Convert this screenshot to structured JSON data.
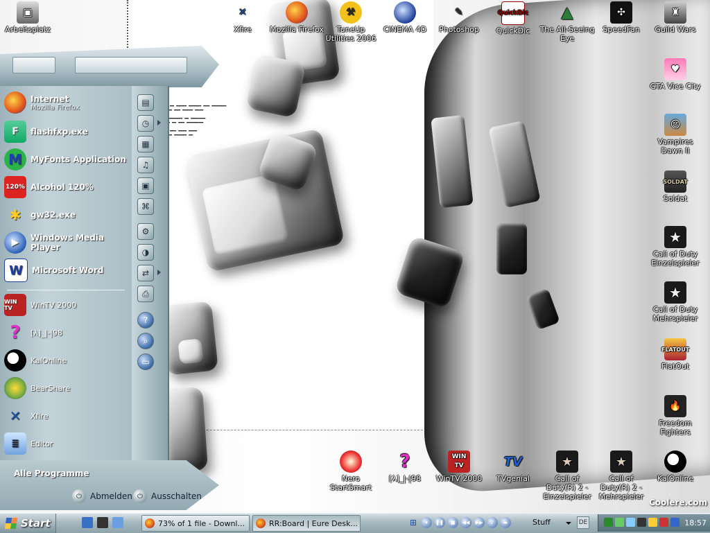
{
  "desktop": {
    "top_icons": [
      {
        "label": "Arbeitsplatz",
        "icon": "computer-icon"
      },
      {
        "label": "Xfire",
        "icon": "xfire-icon"
      },
      {
        "label": "Mozilla Firefox",
        "icon": "firefox-icon"
      },
      {
        "label": "TuneUp Utilities 2006",
        "icon": "tuneup-icon"
      },
      {
        "label": "CINEMA 4D",
        "icon": "cinema4d-icon"
      },
      {
        "label": "Photoshop",
        "icon": "photoshop-icon"
      },
      {
        "label": "QuickDic",
        "icon": "quickdic-icon"
      },
      {
        "label": "The All-Seeing Eye",
        "icon": "all-seeing-eye-icon"
      },
      {
        "label": "SpeedFan",
        "icon": "speedfan-icon"
      },
      {
        "label": "Guild Wars",
        "icon": "guildwars-icon"
      }
    ],
    "right_icons": [
      {
        "label": "GTA Vice City",
        "icon": "gta-icon"
      },
      {
        "label": "Vampires Dawn II",
        "icon": "vampires-dawn-icon"
      },
      {
        "label": "Soldat",
        "icon": "soldat-icon"
      },
      {
        "label": "Call of Duty Einzelspieler",
        "icon": "cod-icon"
      },
      {
        "label": "Call of Duty Mehrspieler",
        "icon": "cod-icon"
      },
      {
        "label": "FlatOut",
        "icon": "flatout-icon"
      },
      {
        "label": "Freedom Fighters",
        "icon": "freedom-fighters-icon"
      }
    ],
    "bottom_icons": [
      {
        "label": "Nero StartSmart",
        "icon": "nero-icon"
      },
      {
        "label": "[λ]_|-|98",
        "icon": "question-icon"
      },
      {
        "label": "WinTV 2000",
        "icon": "wintv-icon"
      },
      {
        "label": "TVgenial",
        "icon": "tvgenial-icon"
      },
      {
        "label": "Call of Duty(R) 2 - Einzelspieler",
        "icon": "cod2-icon"
      },
      {
        "label": "Call of Duty(R) 2 - Mehrspieler",
        "icon": "cod2-icon"
      },
      {
        "label": "KalOnline",
        "icon": "kalonline-icon"
      }
    ],
    "quickdic_caption": "QuickDic",
    "watermark": "Coolere.com"
  },
  "start_menu": {
    "pinned": [
      {
        "title": "Internet",
        "subtitle": "Mozilla Firefox",
        "icon": "firefox-icon"
      },
      {
        "title": "flashfxp.exe",
        "icon": "flashfxp-icon"
      },
      {
        "title": "MyFonts Application",
        "icon": "myfonts-icon"
      },
      {
        "title": "Alcohol 120%",
        "icon": "alcohol-icon"
      },
      {
        "title": "gw32.exe",
        "icon": "gw32-icon"
      },
      {
        "title": "Windows Media Player",
        "icon": "media-player-icon"
      },
      {
        "title": "Microsoft Word",
        "icon": "word-icon"
      }
    ],
    "recent": [
      {
        "title": "WinTV 2000",
        "icon": "wintv-icon"
      },
      {
        "title": "[λ]_|-|98",
        "icon": "question-icon"
      },
      {
        "title": "KalOnline",
        "icon": "kalonline-icon"
      },
      {
        "title": "BearShare",
        "icon": "bearshare-icon"
      },
      {
        "title": "Xfire",
        "icon": "xfire-icon"
      },
      {
        "title": "Editor",
        "icon": "notepad-icon"
      }
    ],
    "all_programs": "Alle Programme",
    "logoff": "Abmelden",
    "shutdown": "Ausschalten"
  },
  "taskbar": {
    "start_label": "Start",
    "tasks": [
      {
        "label": "73% of 1 file - Downl...",
        "icon": "firefox-icon"
      },
      {
        "label": "RR:Board | Eure Desk...",
        "icon": "firefox-icon"
      }
    ],
    "toolbar_label": "Stuff",
    "lang": "DE",
    "clock": "18:57"
  }
}
